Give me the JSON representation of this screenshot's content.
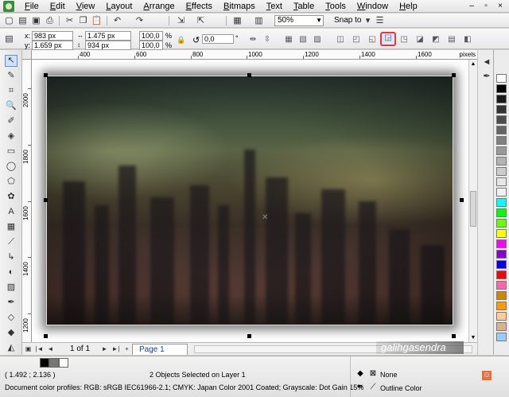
{
  "menu": [
    "File",
    "Edit",
    "View",
    "Layout",
    "Arrange",
    "Effects",
    "Bitmaps",
    "Text",
    "Table",
    "Tools",
    "Window",
    "Help"
  ],
  "window_controls": [
    "–",
    "▫",
    "×"
  ],
  "toolbar": {
    "zoom_value": "50%",
    "snap_to_label": "Snap to"
  },
  "property_bar": {
    "x_label": "x:",
    "x_value": "983 px",
    "y_label": "y:",
    "y_value": "1.659 px",
    "width_value": "1.475 px",
    "height_value": "934 px",
    "scale_x": "100,0",
    "scale_y": "100,0",
    "percent": "%",
    "rotation": "0,0",
    "degree": "°"
  },
  "ruler": {
    "units": "pixels",
    "h_labels": [
      "400",
      "600",
      "800",
      "1000",
      "1200",
      "1400",
      "1600"
    ],
    "v_labels": [
      "2000",
      "1800",
      "1600",
      "1400",
      "1200"
    ]
  },
  "page_nav": {
    "page_count": "1 of 1",
    "page_tab": "Page 1"
  },
  "watermark": "galihgasendra",
  "status": {
    "cursor_position": "( 1.492 ; 2.136 )",
    "selection_info": "2 Objects Selected on Layer 1",
    "color_profiles": "Document color profiles: RGB: sRGB IEC61966-2.1; CMYK: Japan Color 2001 Coated; Grayscale: Dot Gain 15%",
    "fill_label": "None",
    "outline_label": "Outline Color"
  },
  "palette_colors": [
    "#ffffff",
    "#000000",
    "#1a1a1a",
    "#333333",
    "#4d4d4d",
    "#666666",
    "#808080",
    "#999999",
    "#b3b3b3",
    "#cccccc",
    "#e6e6e6",
    "#f2f2f2",
    "#00ffff",
    "#00ff00",
    "#66ff00",
    "#ffff00",
    "#ff00ff",
    "#8800cc",
    "#0000ff",
    "#ff0000",
    "#ff66aa",
    "#cc8800",
    "#ff9900",
    "#ffcc99",
    "#d9b38c",
    "#99ccff"
  ]
}
